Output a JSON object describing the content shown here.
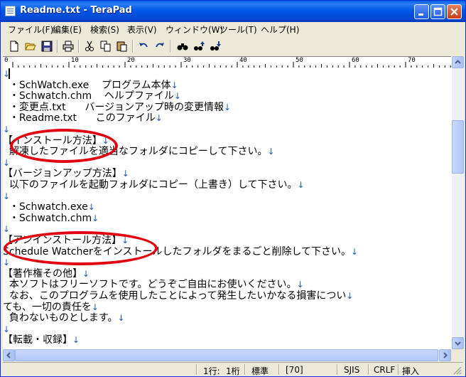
{
  "window": {
    "title": "Readme.txt - TeraPad"
  },
  "menu": [
    "ファイル(F)",
    "編集(E)",
    "検索(S)",
    "表示(V)",
    "ウィンドウ(W)",
    "ツール(T)",
    "ヘルプ(H)"
  ],
  "ruler": [
    "0",
    "10",
    "20",
    "30",
    "40",
    "50",
    "60",
    "70"
  ],
  "lines": [
    {
      "text": ""
    },
    {
      "text": "  ・SchWatch.exe    プログラム本体"
    },
    {
      "text": "  ・Schwatch.chm    ヘルプファイル"
    },
    {
      "text": "  ・変更点.txt      バージョンアップ時の変更情報"
    },
    {
      "text": "  ・Readme.txt      このファイル"
    },
    {
      "text": ""
    },
    {
      "text": "【インストール方法】"
    },
    {
      "text": "  解凍したファイルを適当なフォルダにコピーして下さい。"
    },
    {
      "text": ""
    },
    {
      "text": "【バージョンアップ方法】"
    },
    {
      "text": "  以下のファイルを起動フォルダにコピー（上書き）して下さい。"
    },
    {
      "text": ""
    },
    {
      "text": "  ・Schwatch.exe"
    },
    {
      "text": "  ・Schwatch.chm"
    },
    {
      "text": ""
    },
    {
      "text": "【アンインストール方法】"
    },
    {
      "text": "Schedule Watcherをインストールしたフォルダをまるごと削除して下さい。"
    },
    {
      "text": ""
    },
    {
      "text": "【著作権その他】"
    },
    {
      "text": "  本ソフトはフリーソフトです。どうぞご自由にお使いください。"
    },
    {
      "text": "  なお、このプログラムを使用したことによって発生したいかなる損害につい"
    },
    {
      "text": "ても、一切の責任を"
    },
    {
      "text": "  負わないものとします。"
    },
    {
      "text": ""
    },
    {
      "text": "【転載・収録】"
    }
  ],
  "status": {
    "line": "1行:",
    "col": "1桁",
    "mode": "標準",
    "code": "[70]",
    "encoding": "SJIS",
    "newline": "CRLF",
    "insert": "挿入"
  },
  "icons": {
    "newline_marker": "↓",
    "highlight_color": "#e00010"
  }
}
